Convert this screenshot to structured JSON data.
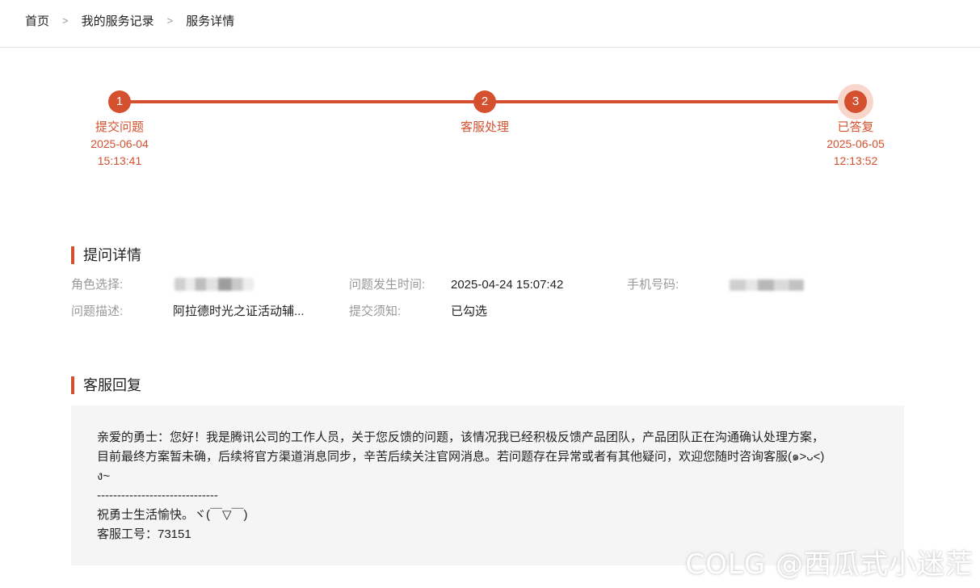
{
  "breadcrumb": {
    "items": [
      "首页",
      "我的服务记录",
      "服务详情"
    ],
    "separator": ">"
  },
  "progress": {
    "steps": [
      {
        "number": "1",
        "label": "提交问题",
        "date": "2025-06-04",
        "time": "15:13:41"
      },
      {
        "number": "2",
        "label": "客服处理",
        "date": "",
        "time": ""
      },
      {
        "number": "3",
        "label": "已答复",
        "date": "2025-06-05",
        "time": "12:13:52",
        "current": true
      }
    ]
  },
  "question": {
    "title": "提问详情",
    "role_label": "角色选择:",
    "time_label": "问题发生时间:",
    "time_value": "2025-04-24 15:07:42",
    "phone_label": "手机号码:",
    "desc_label": "问题描述:",
    "desc_value": "阿拉德时光之证活动辅...",
    "notice_label": "提交须知:",
    "notice_value": "已勾选"
  },
  "reply": {
    "title": "客服回复",
    "lines": [
      "亲爱的勇士：您好！我是腾讯公司的工作人员，关于您反馈的问题，该情况我已经积极反馈产品团队，产品团队正在沟通确认处理方案，",
      "目前最终方案暂未确，后续将官方渠道消息同步，辛苦后续关注官网消息。若问题存在异常或者有其他疑问，欢迎您随时咨询客服(๑>ᴗ<)",
      "ง~",
      "------------------------------",
      "祝勇士生活愉快。ヾ(￣▽￣)",
      "客服工号：73151"
    ]
  },
  "watermark": "COLG @西瓜式小迷茫",
  "colors": {
    "accent": "#d4502e",
    "halo": "#f8d6cc",
    "reply_bg": "#f5f5f5"
  }
}
